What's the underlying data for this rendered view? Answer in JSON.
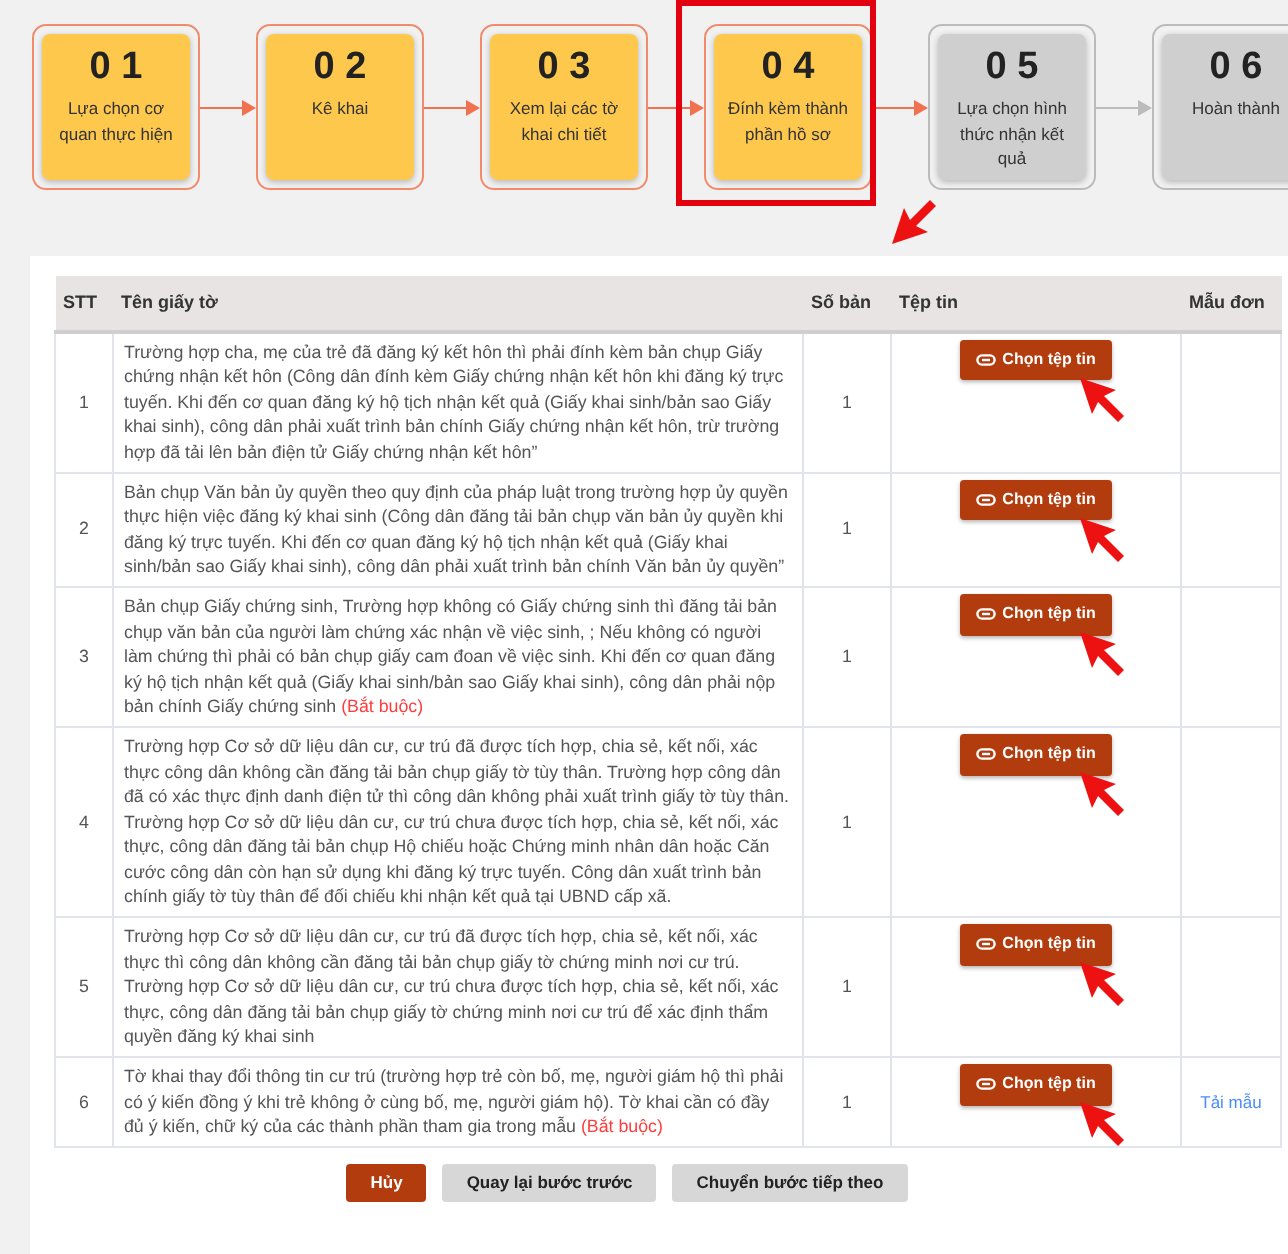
{
  "steps": [
    {
      "number": "0 1",
      "label": "Lựa chọn cơ quan thực hiện",
      "completed": true,
      "highlighted": false
    },
    {
      "number": "0 2",
      "label": "Kê khai",
      "completed": true,
      "highlighted": false
    },
    {
      "number": "0 3",
      "label": "Xem lại các tờ khai chi tiết",
      "completed": true,
      "highlighted": false
    },
    {
      "number": "0 4",
      "label": "Đính kèm thành phần hồ sơ",
      "completed": true,
      "highlighted": true
    },
    {
      "number": "0 5",
      "label": "Lựa chọn hình thức nhận kết quả",
      "completed": false,
      "highlighted": false
    },
    {
      "number": "0 6",
      "label": "Hoàn thành",
      "completed": false,
      "highlighted": false
    }
  ],
  "table": {
    "columns": [
      "STT",
      "Tên giấy tờ",
      "Số bản",
      "Tệp tin",
      "Mẫu đơn"
    ],
    "rows": [
      {
        "index": "1",
        "name": "Trường hợp cha, mẹ của trẻ đã đăng ký kết hôn thì phải đính kèm bản chụp Giấy chứng nhận kết hôn (Công dân đính kèm Giấy chứng nhận kết hôn khi đăng ký trực tuyến. Khi đến cơ quan đăng ký hộ tịch nhận kết quả (Giấy khai sinh/bản sao Giấy khai sinh), công dân phải xuất trình bản chính Giấy chứng nhận kết hôn, trừ trường hợp đã tải lên bản điện tử Giấy chứng nhận kết hôn”",
        "copies": "1",
        "file_button": "Chọn tệp tin",
        "pointer_arrow": true
      },
      {
        "index": "2",
        "name": "Bản chụp Văn bản ủy quyền theo quy định của pháp luật trong trường hợp ủy quyền thực hiện việc đăng ký khai sinh (Công dân đăng tải bản chụp văn bản ủy quyền khi đăng ký trực tuyến. Khi đến cơ quan đăng ký hộ tịch nhận kết quả (Giấy khai sinh/bản sao Giấy khai sinh), công dân phải xuất trình bản chính Văn bản ủy quyền”",
        "copies": "1",
        "file_button": "Chọn tệp tin",
        "pointer_arrow": true
      },
      {
        "index": "3",
        "name": "Bản chụp Giấy chứng sinh, Trường hợp không có Giấy chứng sinh thì đăng tải bản chụp văn bản của người làm chứng xác nhận về việc sinh, ; Nếu không có người làm chứng thì phải có bản chụp giấy cam đoan về việc sinh. Khi đến cơ quan đăng ký hộ tịch nhận kết quả (Giấy khai sinh/bản sao Giấy khai sinh), công dân phải nộp bản chính Giấy chứng sinh",
        "required_note": "(Bắt buộc)",
        "copies": "1",
        "file_button": "Chọn tệp tin",
        "pointer_arrow": true
      },
      {
        "index": "4",
        "name": "Trường hợp Cơ sở dữ liệu dân cư, cư trú đã được tích hợp, chia sẻ, kết nối, xác thực công dân không cần đăng tải bản chụp giấy tờ tùy thân. Trường hợp công dân đã có xác thực định danh điện tử thì công dân không phải xuất trình giấy tờ tùy thân. Trường hợp Cơ sở dữ liệu dân cư, cư trú chưa được tích hợp, chia sẻ, kết nối, xác thực, công dân đăng tải bản chụp Hộ chiếu hoặc Chứng minh nhân dân hoặc Căn cước công dân còn hạn sử dụng khi đăng ký trực tuyến. Công dân xuất trình bản chính giấy tờ tùy thân để đối chiếu khi nhận kết quả tại UBND cấp xã.",
        "copies": "1",
        "file_button": "Chọn tệp tin",
        "pointer_arrow": true
      },
      {
        "index": "5",
        "name": "Trường hợp Cơ sở dữ liệu dân cư, cư trú đã được tích hợp, chia sẻ, kết nối, xác thực thì công dân không cần đăng tải bản chụp giấy tờ chứng minh nơi cư trú. Trường hợp Cơ sở dữ liệu dân cư, cư trú chưa được tích hợp, chia sẻ, kết nối, xác thực, công dân đăng tải bản chụp giấy tờ chứng minh nơi cư trú để xác định thẩm quyền đăng ký khai sinh",
        "copies": "1",
        "file_button": "Chọn tệp tin",
        "pointer_arrow": true
      },
      {
        "index": "6",
        "name": "Tờ khai thay đổi thông tin cư trú (trường hợp trẻ còn bố, mẹ, người giám hộ thì phải có ý kiến đồng ý khi trẻ không ở cùng bố, mẹ, người giám hộ). Tờ khai cần có đầy đủ ý kiến, chữ ký của các thành phần tham gia trong mẫu",
        "required_note": "(Bắt buộc)",
        "copies": "1",
        "file_button": "Chọn tệp tin",
        "template_link": "Tải mẫu",
        "pointer_arrow": true
      }
    ]
  },
  "buttons": [
    {
      "label": "Hủy",
      "kind": "danger"
    },
    {
      "label": "Quay lại bước trước",
      "kind": "secondary"
    },
    {
      "label": "Chuyển bước tiếp theo",
      "kind": "secondary"
    }
  ]
}
